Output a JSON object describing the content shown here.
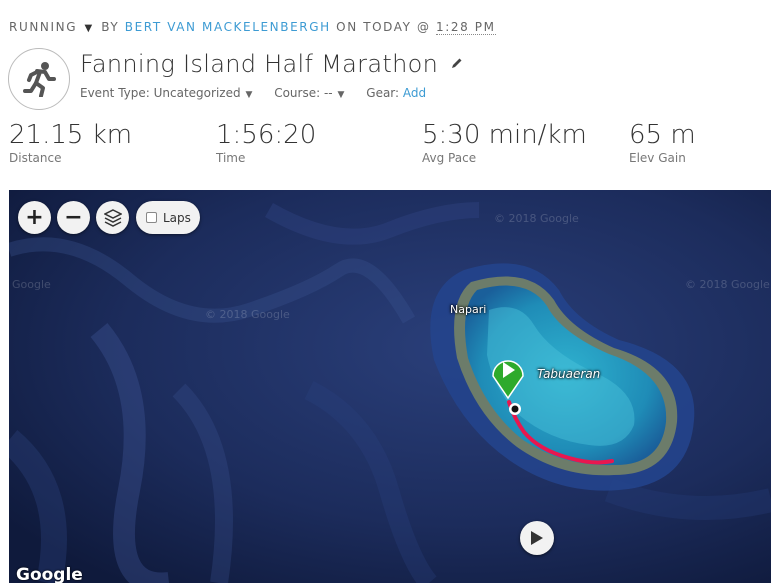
{
  "header": {
    "activity_type": "RUNNING",
    "by_label": "BY",
    "author": "BERT VAN MACKELENBERGH",
    "on_label": "ON TODAY @",
    "time": "1:28 PM"
  },
  "activity": {
    "title": "Fanning Island Half Marathon",
    "event_type_label": "Event Type:",
    "event_type_value": "Uncategorized",
    "course_label": "Course:",
    "course_value": "--",
    "gear_label": "Gear:",
    "gear_action": "Add"
  },
  "stats": [
    {
      "value": "21.15 km",
      "label": "Distance"
    },
    {
      "value": "1:56:20",
      "label": "Time"
    },
    {
      "value": "5:30 min/km",
      "label": "Avg Pace"
    },
    {
      "value": "65 m",
      "label": "Elev Gain"
    }
  ],
  "map": {
    "zoom_in": "+",
    "zoom_out": "−",
    "laps_label": "Laps",
    "places": [
      "Napari",
      "Tabuaeran"
    ],
    "watermarks": [
      "© 2018 Google",
      "Google",
      "© 2018 Google",
      "© 2018 Google"
    ],
    "logo": "Google",
    "route_color": "#e8174f",
    "start_marker_color": "#2eaa2c"
  },
  "icons": [
    "running-person-icon",
    "pencil-icon",
    "layers-icon",
    "play-icon"
  ]
}
